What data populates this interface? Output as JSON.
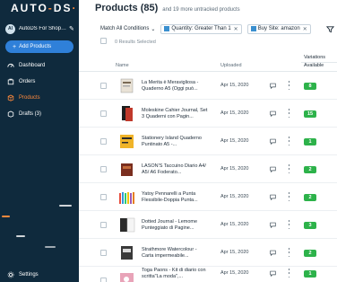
{
  "sidebar": {
    "logo_text": "AUTO",
    "logo_dash": "-",
    "logo_suffix": "DS",
    "logo_dot": "·",
    "store_initials": "AI",
    "store_name": "AutoDS For Shopif...",
    "add_button": "Add Products",
    "nav": [
      {
        "label": "Dashboard",
        "icon": "dashboard-icon"
      },
      {
        "label": "Orders",
        "icon": "orders-icon"
      },
      {
        "label": "Products",
        "icon": "products-icon",
        "active": true
      },
      {
        "label": "Drafts (3)",
        "icon": "drafts-icon"
      }
    ],
    "settings_label": "Settings"
  },
  "header": {
    "title": "Products (85)",
    "untracked": "and 19 more untracked products"
  },
  "filters": {
    "match": "Match All Conditions",
    "chips": [
      "Quantity: Greater Than 1",
      "Buy Site: amazon"
    ]
  },
  "table": {
    "selected": "0 Results Selected",
    "headers": {
      "name": "Name",
      "uploaded": "Uploaded",
      "variations": "Variations",
      "available": "Available"
    },
    "rows": [
      {
        "title": "La Merita è Meravigliosa - Quaderno A5 (Oggi può...",
        "date": "Apr 15, 2020",
        "available": "8"
      },
      {
        "title": "Moleskine Cahier Journal, Set 3 Quaderni con Pagin...",
        "date": "Apr 15, 2020",
        "available": "15"
      },
      {
        "title": "Stationery Island Quaderno Puntinato A5 -...",
        "date": "Apr 15, 2020",
        "available": "1"
      },
      {
        "title": "LASON'S Taccuino Diario A4/ A5/ A6 Foderato...",
        "date": "Apr 15, 2020",
        "available": "2"
      },
      {
        "title": "Yatoy Pennarelli a Punta Flessibile-Doppia Punta...",
        "date": "Apr 15, 2020",
        "available": "2"
      },
      {
        "title": "Dotted Journal - Lemome Punteggiato di Pagine...",
        "date": "Apr 15, 2020",
        "available": "3"
      },
      {
        "title": "Strathmore Watercolour - Carta impermeabile...",
        "date": "Apr 15, 2020",
        "available": "2"
      },
      {
        "title": "Toga Paons - Kit di diario con scritta\"La moda\",...",
        "date": "Apr 15, 2020",
        "available": "1"
      }
    ]
  },
  "colors": {
    "sidebar": "#0f2a3d",
    "accent": "#2f80d9",
    "active": "#ff8a3d",
    "badge": "#2db24a"
  }
}
